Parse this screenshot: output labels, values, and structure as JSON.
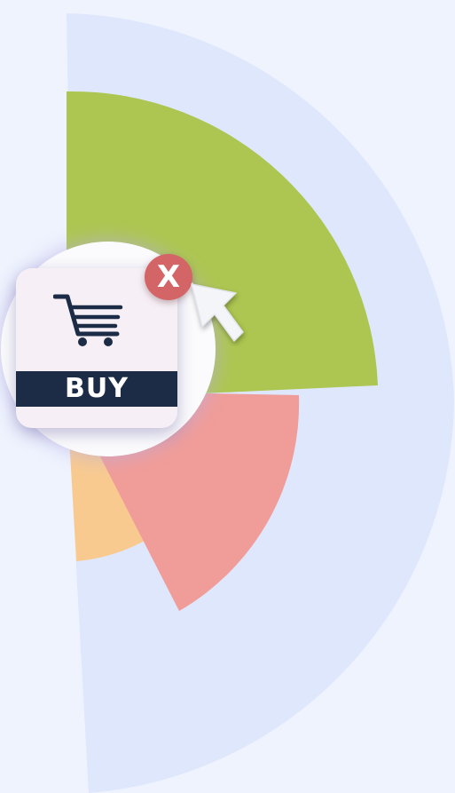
{
  "wedges": {
    "background_color": "#dfe7fd",
    "green_color": "#adc651",
    "pink_color": "#f09c98",
    "orange_color": "#f8ca90"
  },
  "badge": {
    "label": "BUY",
    "icon": "shopping-cart-icon",
    "band_color": "#1c2c47"
  },
  "close_button": {
    "glyph": "X",
    "icon": "close-icon",
    "color": "#d46566"
  },
  "cursor": {
    "icon": "mouse-pointer-icon"
  }
}
